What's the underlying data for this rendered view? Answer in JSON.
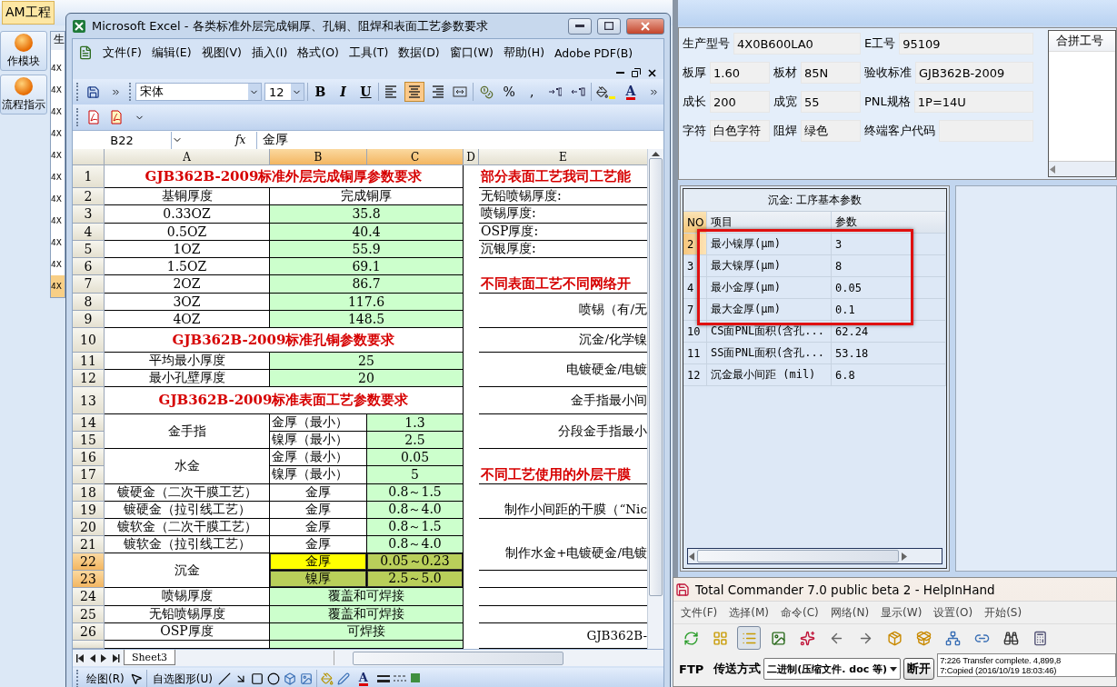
{
  "left_app": {
    "menu": [
      {
        "label": "AM工程",
        "selected": true
      }
    ],
    "buttons": [
      "作模块",
      "流程指示"
    ],
    "list_header": "生",
    "list_rows": [
      {
        "label": "4X",
        "selected": false
      },
      {
        "label": "4X",
        "selected": false
      },
      {
        "label": "4X",
        "selected": false
      },
      {
        "label": "4X",
        "selected": false
      },
      {
        "label": "4X",
        "selected": false
      },
      {
        "label": "4X",
        "selected": false
      },
      {
        "label": "4X",
        "selected": false
      },
      {
        "label": "4X",
        "selected": false
      },
      {
        "label": "4X",
        "selected": false
      },
      {
        "label": "4X",
        "selected": false
      },
      {
        "label": "4X",
        "selected": true
      }
    ]
  },
  "excel": {
    "title": "Microsoft Excel - 各类标准外层完成铜厚、孔铜、阻焊和表面工艺参数要求",
    "menu": [
      "文件(F)",
      "编辑(E)",
      "视图(V)",
      "插入(I)",
      "格式(O)",
      "工具(T)",
      "数据(D)",
      "窗口(W)",
      "帮助(H)",
      "Adobe PDF(B)"
    ],
    "font": "宋体",
    "size": "12",
    "style_buttons": [
      "B",
      "I",
      "U"
    ],
    "align_buttons": [
      {
        "selected": false
      },
      {
        "selected": true
      },
      {
        "selected": false
      },
      {
        "selected": false
      }
    ],
    "number_buttons": [
      "%",
      ","
    ],
    "font_color_label": "A",
    "name_box": "B22",
    "fx_label": "fx",
    "formula": "金厚",
    "columns": [
      {
        "label": "A",
        "selected": false
      },
      {
        "label": "B",
        "selected": true
      },
      {
        "label": "C",
        "selected": true
      },
      {
        "label": "D",
        "selected": false
      },
      {
        "label": "E",
        "selected": false
      }
    ],
    "rows": [
      {
        "header": "1",
        "selected": false,
        "cells": {
          "abc": {
            "text": "GJB362B-2009标准外层完成铜厚参数要求",
            "kind": "title",
            "selected": false
          },
          "e": {
            "text": "部分表面工艺我司工艺能",
            "kind": "title-left",
            "selected": false
          }
        }
      },
      {
        "header": "2",
        "selected": false,
        "cells": {
          "a": {
            "text": "基铜厚度",
            "kind": "text",
            "selected": false
          },
          "bc": {
            "text": "完成铜厚",
            "kind": "text",
            "selected": false
          },
          "e": {
            "text": "无铅喷锡厚度:",
            "kind": "text-left",
            "selected": false
          }
        }
      },
      {
        "header": "3",
        "selected": false,
        "cells": {
          "a": {
            "text": "0.33OZ",
            "kind": "text",
            "selected": false
          },
          "bc": {
            "text": "35.8",
            "kind": "value",
            "selected": false
          },
          "e": {
            "text": "喷锡厚度:",
            "kind": "text-left",
            "selected": false
          }
        }
      },
      {
        "header": "4",
        "selected": false,
        "cells": {
          "a": {
            "text": "0.5OZ",
            "kind": "text",
            "selected": false
          },
          "bc": {
            "text": "40.4",
            "kind": "value",
            "selected": false
          },
          "e": {
            "text": "OSP厚度:",
            "kind": "text-left",
            "selected": false
          }
        }
      },
      {
        "header": "5",
        "selected": false,
        "cells": {
          "a": {
            "text": "1OZ",
            "kind": "text",
            "selected": false
          },
          "bc": {
            "text": "55.9",
            "kind": "value",
            "selected": false
          },
          "e": {
            "text": "沉银厚度:",
            "kind": "text-left",
            "selected": false
          }
        }
      },
      {
        "header": "6",
        "selected": false,
        "cells": {
          "a": {
            "text": "1.5OZ",
            "kind": "text",
            "selected": false
          },
          "bc": {
            "text": "69.1",
            "kind": "value",
            "selected": false
          }
        }
      },
      {
        "header": "7",
        "selected": false,
        "cells": {
          "a": {
            "text": "2OZ",
            "kind": "text",
            "selected": false
          },
          "bc": {
            "text": "86.7",
            "kind": "value",
            "selected": false
          },
          "e": {
            "text": "不同表面工艺不同网络开",
            "kind": "title-left",
            "selected": false
          }
        }
      },
      {
        "header": "8",
        "selected": false,
        "cells": {
          "a": {
            "text": "3OZ",
            "kind": "text",
            "selected": false
          },
          "bc": {
            "text": "117.6",
            "kind": "value",
            "selected": false
          },
          "e": {
            "text": "喷锡（有/无",
            "kind": "clipped",
            "selected": false
          }
        }
      },
      {
        "header": "9",
        "selected": false,
        "cells": {
          "a": {
            "text": "4OZ",
            "kind": "text",
            "selected": false
          },
          "bc": {
            "text": "148.5",
            "kind": "value",
            "selected": false
          },
          "e": {
            "merged_up": true
          }
        }
      },
      {
        "header": "10",
        "selected": false,
        "cells": {
          "abc": {
            "text": "GJB362B-2009标准孔铜参数要求",
            "kind": "title",
            "selected": false
          },
          "e": {
            "text": "沉金/化学镍",
            "kind": "clipped",
            "selected": false
          }
        }
      },
      {
        "header": "11",
        "selected": false,
        "cells": {
          "a": {
            "text": "平均最小厚度",
            "kind": "text",
            "selected": false
          },
          "bc": {
            "text": "25",
            "kind": "value",
            "selected": false
          },
          "e": {
            "text": "电镀硬金/电镀",
            "kind": "clipped",
            "selected": false
          }
        }
      },
      {
        "header": "12",
        "selected": false,
        "cells": {
          "a": {
            "text": "最小孔壁厚度",
            "kind": "text",
            "selected": false
          },
          "bc": {
            "text": "20",
            "kind": "value",
            "selected": false
          },
          "e": {
            "merged_up": true
          }
        }
      },
      {
        "header": "13",
        "selected": false,
        "cells": {
          "abc": {
            "text": "GJB362B-2009标准表面工艺参数要求",
            "kind": "title",
            "selected": false
          },
          "e": {
            "text": "金手指最小间",
            "kind": "clipped",
            "selected": false
          }
        }
      },
      {
        "header": "14",
        "selected": false,
        "cells": {
          "a": {
            "text": "金手指",
            "kind": "text",
            "selected": false
          },
          "b": {
            "text": "金厚（最小）",
            "kind": "text-left",
            "selected": false
          },
          "c": {
            "text": "1.3",
            "kind": "value",
            "selected": false
          },
          "e": {
            "text": "分段金手指最小",
            "kind": "clipped",
            "selected": false
          }
        }
      },
      {
        "header": "15",
        "selected": false,
        "cells": {
          "a": {
            "merged_up": true
          },
          "b": {
            "text": "镍厚（最小）",
            "kind": "text-left",
            "selected": false
          },
          "c": {
            "text": "2.5",
            "kind": "value",
            "selected": false
          },
          "e": {
            "merged_up": true
          }
        }
      },
      {
        "header": "16",
        "selected": false,
        "cells": {
          "a": {
            "text": "水金",
            "kind": "text",
            "selected": false
          },
          "b": {
            "text": "金厚（最小）",
            "kind": "text-left",
            "selected": false
          },
          "c": {
            "text": "0.05",
            "kind": "value",
            "selected": false
          }
        }
      },
      {
        "header": "17",
        "selected": false,
        "cells": {
          "a": {
            "merged_up": true
          },
          "b": {
            "text": "镍厚（最小）",
            "kind": "text-left",
            "selected": false
          },
          "c": {
            "text": "5",
            "kind": "value",
            "selected": false
          },
          "e": {
            "text": "不同工艺使用的外层干膜",
            "kind": "title-left",
            "selected": false
          }
        }
      },
      {
        "header": "18",
        "selected": false,
        "cells": {
          "a": {
            "text": "镀硬金（二次干膜工艺）",
            "kind": "text",
            "selected": false
          },
          "b": {
            "text": "金厚",
            "kind": "text",
            "selected": false
          },
          "c": {
            "text": "0.8～1.5",
            "kind": "value",
            "selected": false
          }
        }
      },
      {
        "header": "19",
        "selected": false,
        "cells": {
          "a": {
            "text": "镀硬金（拉引线工艺）",
            "kind": "text",
            "selected": false
          },
          "b": {
            "text": "金厚",
            "kind": "text",
            "selected": false
          },
          "c": {
            "text": "0.8～4.0",
            "kind": "value",
            "selected": false
          },
          "e": {
            "text": "制作小间距的干膜（“Nic",
            "kind": "clipped",
            "selected": false
          }
        }
      },
      {
        "header": "20",
        "selected": false,
        "cells": {
          "a": {
            "text": "镀软金（二次干膜工艺）",
            "kind": "text",
            "selected": false
          },
          "b": {
            "text": "金厚",
            "kind": "text",
            "selected": false
          },
          "c": {
            "text": "0.8～1.5",
            "kind": "value",
            "selected": false
          }
        }
      },
      {
        "header": "21",
        "selected": false,
        "cells": {
          "a": {
            "text": "镀软金（拉引线工艺）",
            "kind": "text",
            "selected": false
          },
          "b": {
            "text": "金厚",
            "kind": "text",
            "selected": false
          },
          "c": {
            "text": "0.8～4.0",
            "kind": "value",
            "selected": false
          },
          "e": {
            "text": "制作水金+电镀硬金/电镀",
            "kind": "clipped",
            "selected": false
          }
        }
      },
      {
        "header": "22",
        "selected": true,
        "cells": {
          "a": {
            "text": "沉金",
            "kind": "text",
            "selected": false
          },
          "b": {
            "text": "金厚",
            "kind": "highlight",
            "selected": true
          },
          "c": {
            "text": "0.05～0.23",
            "kind": "value",
            "selected": true
          },
          "e": {
            "merged_up": true
          }
        }
      },
      {
        "header": "23",
        "selected": true,
        "cells": {
          "a": {
            "merged_up": true
          },
          "b": {
            "text": "镍厚",
            "kind": "value",
            "selected": true
          },
          "c": {
            "text": "2.5～5.0",
            "kind": "value",
            "selected": true
          },
          "e": {
            "kind": "text",
            "selected": false
          }
        }
      },
      {
        "header": "24",
        "selected": false,
        "cells": {
          "a": {
            "text": "喷锡厚度",
            "kind": "text",
            "selected": false
          },
          "bc": {
            "text": "覆盖和可焊接",
            "kind": "value",
            "selected": false
          },
          "e": {
            "kind": "text",
            "selected": false
          }
        }
      },
      {
        "header": "25",
        "selected": false,
        "cells": {
          "a": {
            "text": "无铅喷锡厚度",
            "kind": "text",
            "selected": false
          },
          "bc": {
            "text": "覆盖和可焊接",
            "kind": "value",
            "selected": false
          },
          "e": {
            "kind": "text",
            "selected": false
          }
        }
      },
      {
        "header": "26",
        "selected": false,
        "cells": {
          "a": {
            "text": "OSP厚度",
            "kind": "text",
            "selected": false
          },
          "bc": {
            "text": "可焊接",
            "kind": "value",
            "selected": false
          },
          "e": {
            "text": "GJB362B-",
            "kind": "clipped",
            "selected": false
          }
        }
      },
      {
        "selected": false,
        "cells": {
          "a": {
            "kind": "text",
            "selected": false
          },
          "bc": {
            "kind": "value",
            "selected": false
          },
          "e": {
            "merged_up": true
          }
        }
      }
    ],
    "sheet_tab": "Sheet3",
    "draw_menu": "绘图(R)",
    "autoshape_menu": "自选图形(U)",
    "draw_font_color_label": "A"
  },
  "right_app": {
    "form_rows": [
      {
        "fields": [
          {
            "label": "生产型号",
            "value": "4X0B600LA0"
          },
          {
            "label": "E工号",
            "value": "95109"
          }
        ]
      },
      {
        "fields": [
          {
            "label": "板厚",
            "value": "1.60"
          },
          {
            "label": "板材",
            "value": "85N"
          },
          {
            "label": "验收标准",
            "value": "GJB362B-2009"
          }
        ]
      },
      {
        "fields": [
          {
            "label": "成长",
            "value": "200"
          },
          {
            "label": "成宽",
            "value": "55"
          },
          {
            "label": "PNL规格",
            "value": "1P=14U"
          }
        ]
      },
      {
        "fields": [
          {
            "label": "字符",
            "value": "白色字符"
          },
          {
            "label": "阻焊",
            "value": "绿色"
          },
          {
            "label": "终端客户代码"
          }
        ]
      }
    ],
    "merge_list_header": "合拼工号",
    "table": {
      "title": "沉金: 工序基本参数",
      "columns": [
        "NO",
        "项目",
        "参数"
      ],
      "rows": [
        {
          "no": "2",
          "item": "最小镍厚(μm)",
          "value": "3",
          "selected": true,
          "framed": true
        },
        {
          "no": "3",
          "item": "最大镍厚(μm)",
          "value": "8",
          "selected": false,
          "framed": true
        },
        {
          "no": "4",
          "item": "最小金厚(μm)",
          "value": "0.05",
          "selected": false,
          "framed": true
        },
        {
          "no": "7",
          "item": "最大金厚(μm)",
          "value": "0.1",
          "selected": false,
          "framed": true
        },
        {
          "no": "10",
          "item": "CS面PNL面积(含孔...",
          "value": "62.24",
          "selected": false,
          "framed": false
        },
        {
          "no": "11",
          "item": "SS面PNL面积(含孔...",
          "value": "53.18",
          "selected": false,
          "framed": false
        },
        {
          "no": "12",
          "item": "沉金最小间距 (mil)",
          "value": "6.8",
          "selected": false,
          "framed": false
        }
      ]
    }
  },
  "total_commander": {
    "title": "Total Commander 7.0 public beta 2 - HelpInHand",
    "menu": [
      "文件(F)",
      "选择(M)",
      "命令(C)",
      "网络(N)",
      "显示(W)",
      "设置(O)",
      "开始(S)"
    ],
    "toolbar": [
      {
        "selected": false
      },
      {
        "selected": false
      },
      {
        "selected": true
      },
      {
        "selected": false
      },
      {
        "selected": false
      },
      {
        "selected": false
      },
      {
        "selected": false
      },
      {
        "selected": false
      },
      {
        "selected": false
      },
      {
        "selected": false
      },
      {
        "selected": false
      },
      {
        "selected": false
      },
      {
        "selected": false
      }
    ],
    "ftp_label": "FTP",
    "transfer_label": "传送方式",
    "transfer_mode": "二进制(压缩文件. doc 等)",
    "disconnect": "断开",
    "log": [
      "7:226 Transfer complete. 4,899,8",
      "7:Copied (2016/10/19 18:03:46)"
    ]
  }
}
